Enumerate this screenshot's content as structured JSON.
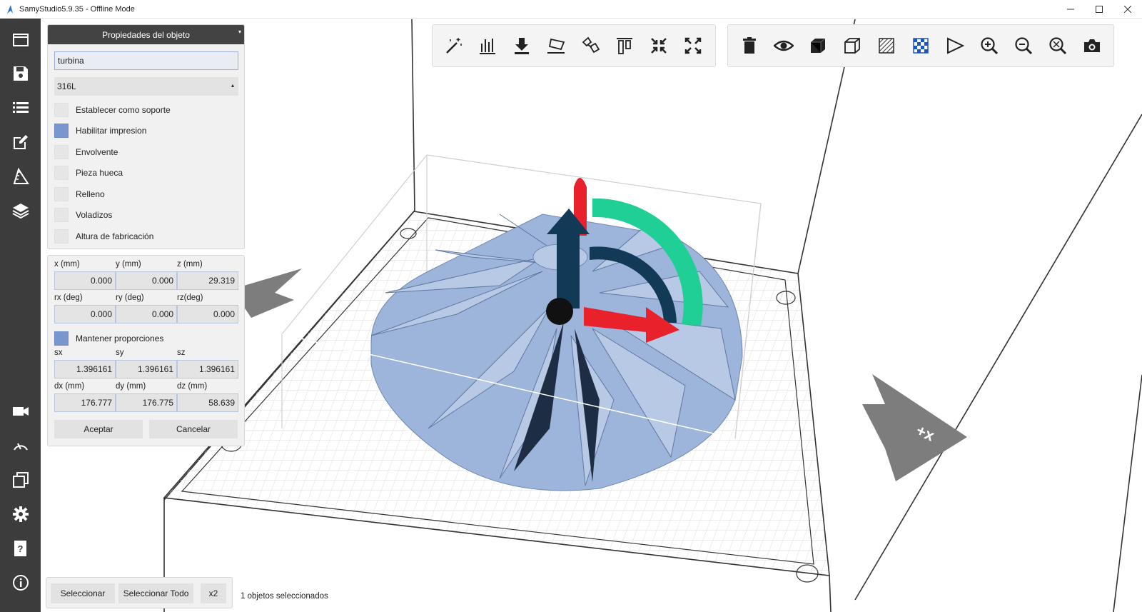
{
  "window": {
    "title": "SamyStudio5.9.35 - Offline Mode",
    "controls": [
      "minimize",
      "maximize",
      "close"
    ]
  },
  "left_toolbar": [
    {
      "icon": "window-icon"
    },
    {
      "icon": "save-icon"
    },
    {
      "icon": "list-icon"
    },
    {
      "icon": "edit-icon"
    },
    {
      "icon": "ruler-icon"
    },
    {
      "icon": "layers-icon"
    },
    {
      "icon": "camera-video-icon"
    },
    {
      "icon": "speedometer-icon"
    },
    {
      "icon": "copies-icon"
    },
    {
      "icon": "settings-icon"
    },
    {
      "icon": "help-icon"
    },
    {
      "icon": "info-icon"
    }
  ],
  "properties": {
    "header": "Propiedades del objeto",
    "name": "turbina",
    "material": "316L",
    "options": [
      {
        "label": "Establecer como soporte",
        "checked": false
      },
      {
        "label": "Habilitar impresion",
        "checked": true
      },
      {
        "label": "Envolvente",
        "checked": false
      },
      {
        "label": "Pieza hueca",
        "checked": false
      },
      {
        "label": "Relleno",
        "checked": false
      },
      {
        "label": "Voladizos",
        "checked": false
      },
      {
        "label": "Altura de fabricación",
        "checked": false
      }
    ]
  },
  "transform": {
    "position": {
      "labels": [
        "x (mm)",
        "y (mm)",
        "z (mm)"
      ],
      "values": [
        "0.000",
        "0.000",
        "29.319"
      ]
    },
    "rotation": {
      "labels": [
        "rx (deg)",
        "ry (deg)",
        "rz(deg)"
      ],
      "values": [
        "0.000",
        "0.000",
        "0.000"
      ]
    },
    "keep_proportions": {
      "label": "Mantener proporciones",
      "checked": true
    },
    "scale": {
      "labels": [
        "sx",
        "sy",
        "sz"
      ],
      "values": [
        "1.396161",
        "1.396161",
        "1.396161"
      ]
    },
    "dimensions": {
      "labels": [
        "dx (mm)",
        "dy (mm)",
        "dz (mm)"
      ],
      "values": [
        "176.777",
        "176.775",
        "58.639"
      ]
    },
    "accept": "Aceptar",
    "cancel": "Cancelar"
  },
  "toolbar_left": [
    "magic-wand-icon",
    "supports-icon",
    "drop-to-bed-icon",
    "lay-flat-icon",
    "rotate-face-icon",
    "align-icon",
    "shrink-icon",
    "expand-icon"
  ],
  "toolbar_right": [
    "delete-icon",
    "eye-icon",
    "solid-cube-icon",
    "wire-cube-icon",
    "hatch-icon",
    "checker-icon",
    "flag-icon",
    "zoom-in-icon",
    "zoom-out-icon",
    "zoom-fit-icon",
    "camera-icon"
  ],
  "bottom": {
    "select": "Seleccionar",
    "select_all": "Seleccionar Todo",
    "duplicate": "x2",
    "status": "1 objetos seleccionados"
  },
  "viewport": {
    "x_axis_label": "+x",
    "colors": {
      "model": "#9db4db",
      "arrow_x": "#e8212b",
      "arrow_z": "#123a56",
      "ring": "#1fcf95",
      "grid": "#d9d9d9",
      "marker": "#7d7d7d"
    }
  }
}
